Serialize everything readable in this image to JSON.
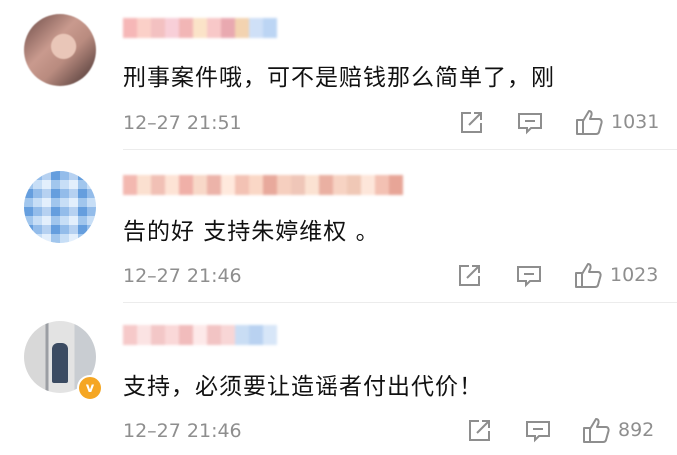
{
  "comments": [
    {
      "text": "刑事案件哦，可不是赔钱那么简单了，刚",
      "time": "12–27 21:51",
      "likes": "1031",
      "name_colors": [
        "#f6b7b7",
        "#fbd0c8",
        "#f3c1c1",
        "#f8cfd8",
        "#f2b6b6",
        "#fbe3c8",
        "#f8c8c8",
        "#e9a9b0",
        "#f3d3b0",
        "#cfe0f7",
        "#bcd5f4"
      ]
    },
    {
      "text": "告的好 支持朱婷维权 。",
      "time": "12–27 21:46",
      "likes": "1023",
      "name_colors": [
        "#f3b8b0",
        "#fbe0d0",
        "#f1c0b5",
        "#fde3d5",
        "#f0b0a8",
        "#f8d8c8",
        "#ecb3a9",
        "#ffe9dd",
        "#f3c2b4",
        "#fad7c6",
        "#e8a99c",
        "#f6cfbf",
        "#efc6b8",
        "#fbe2d2",
        "#eab0a2",
        "#f7d3c3",
        "#f0c8b6",
        "#fde6da",
        "#f3c1b3",
        "#e7a597"
      ]
    },
    {
      "text": "支持，必须要让造谣者付出代价！",
      "time": "12–27 21:46",
      "likes": "892",
      "verified_badge": "v",
      "name_colors": [
        "#f6c9c9",
        "#fbe3e3",
        "#f3c7c7",
        "#fad8d8",
        "#f1bcbc",
        "#fde9e9",
        "#f2c4c4",
        "#f8d6d6",
        "#c9ddf4",
        "#b9d2f1",
        "#d7e6f8"
      ]
    }
  ],
  "icons": {
    "share": "share-icon",
    "comment": "comment-icon",
    "like": "thumbs-up-icon"
  },
  "colors": {
    "text": "#111111",
    "meta": "#8e8e8e",
    "verified": "#f5a623"
  }
}
